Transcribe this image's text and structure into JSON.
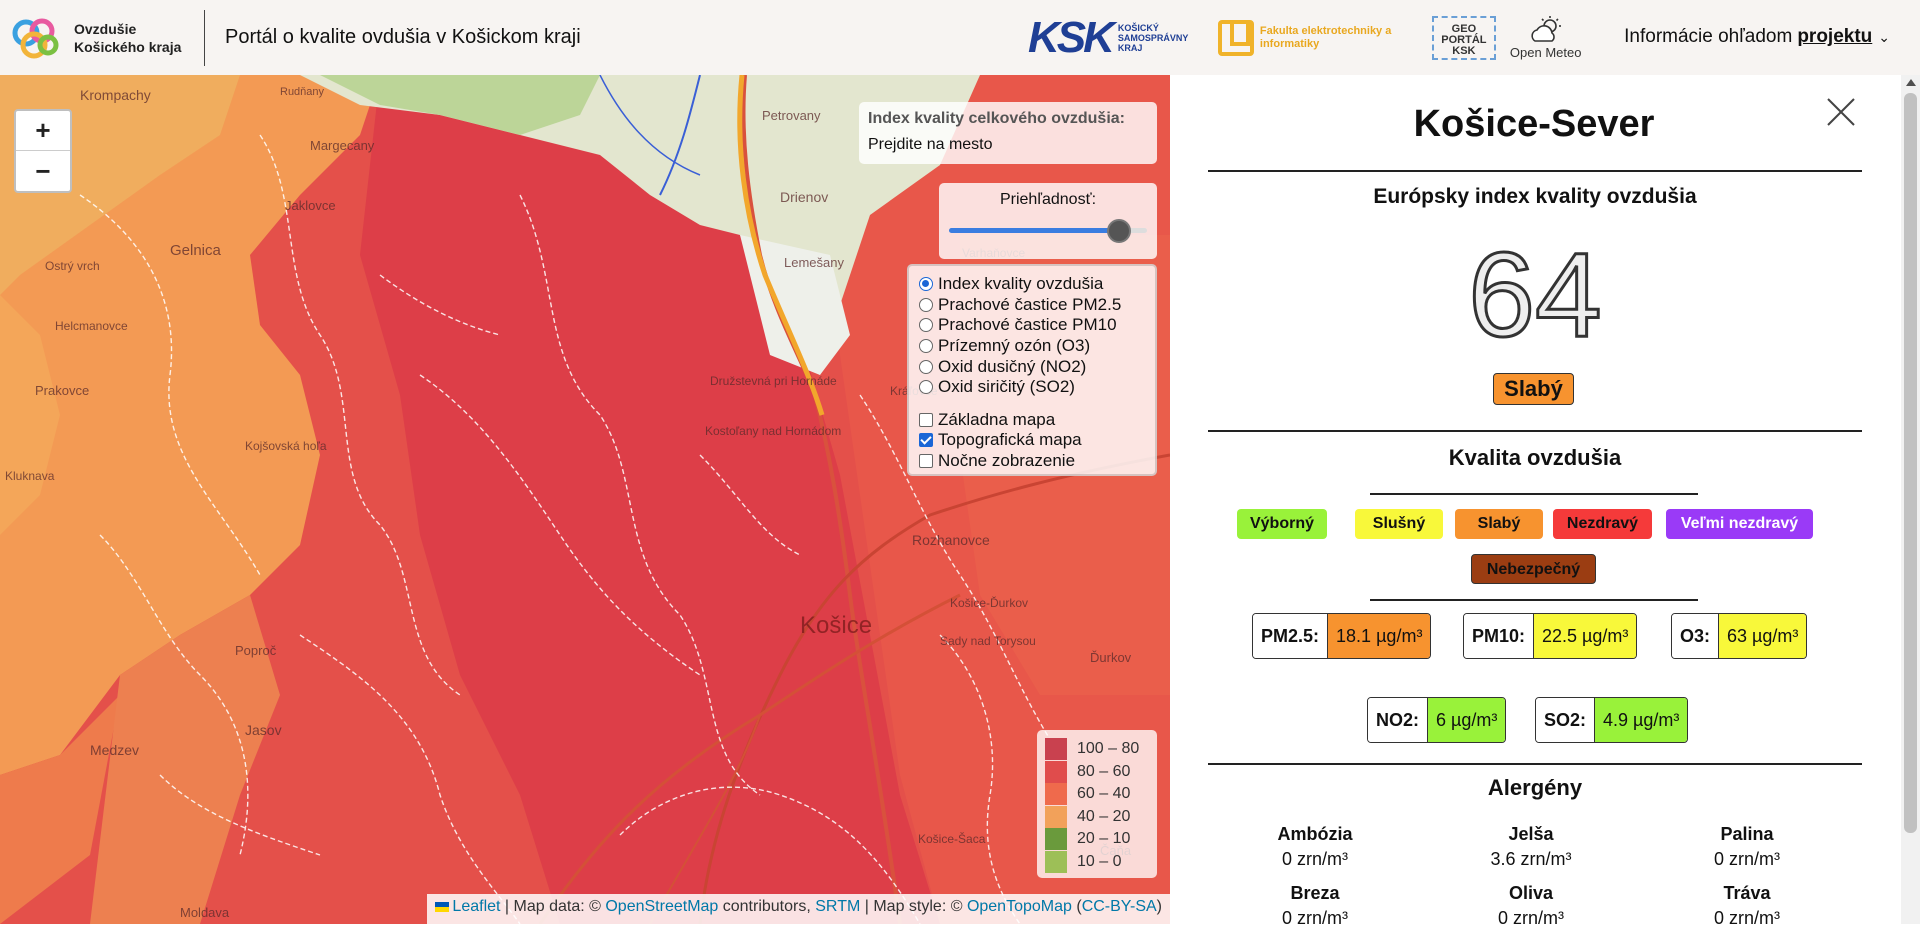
{
  "header": {
    "brand_line1": "Ovzdušie",
    "brand_line2": "Košického kraja",
    "portal_title": "Portál o kvalite ovdušia v Košickom kraji",
    "ksk_mark": "KSK",
    "ksk_text": "KOŠICKÝ SAMOSPRÁVNY KRAJ",
    "fei_text": "Fakulta elektrotechniky a informatiky",
    "geo_text": "GEO PORTÁL KSK",
    "meteo_text": "Open Meteo",
    "info_prefix": "Informácie ohľadom",
    "info_link": "projektu"
  },
  "map": {
    "zoom_in": "+",
    "zoom_out": "−",
    "aqi_info_title": "Index kvality celkového ovzdušia:",
    "aqi_info_hint": "Prejdite na mesto",
    "opacity_label": "Priehľadnosť:",
    "opacity_value": 0.86,
    "layers_radio": [
      {
        "label": "Index kvality ovzdušia",
        "checked": true
      },
      {
        "label": "Prachové častice PM2.5",
        "checked": false
      },
      {
        "label": "Prachové častice PM10",
        "checked": false
      },
      {
        "label": "Prízemný ozón (O3)",
        "checked": false
      },
      {
        "label": "Oxid dusičný (NO2)",
        "checked": false
      },
      {
        "label": "Oxid siričitý (SO2)",
        "checked": false
      }
    ],
    "layers_check": [
      {
        "label": "Základna mapa",
        "checked": false
      },
      {
        "label": "Topografická mapa",
        "checked": true
      },
      {
        "label": "Nočne zobrazenie",
        "checked": false
      }
    ],
    "legend": [
      {
        "label": "100 – 80",
        "color": "#c9414f"
      },
      {
        "label": "80 – 60",
        "color": "#e04c4c"
      },
      {
        "label": "60 – 40",
        "color": "#ef6a4c"
      },
      {
        "label": "40 – 20",
        "color": "#f2a15a"
      },
      {
        "label": "20 – 10",
        "color": "#6a9a3c"
      },
      {
        "label": "10 – 0",
        "color": "#9dbf57"
      }
    ],
    "place_labels": [
      "Krompachy",
      "Rudňany",
      "Margecany",
      "Jaklovce",
      "Gelnica",
      "Ostrý vrch",
      "Helcmanovce",
      "Prakovce",
      "Kojšovská hoľa",
      "Kluknava",
      "Petrovany",
      "Drienov",
      "Lemešany",
      "Varhaňovce",
      "Družstevná pri Hornáde",
      "Kostoľany nad Hornádom",
      "Rozhanovce",
      "Košice",
      "Košice-Ďurkov",
      "Sady nad Torysou",
      "Ďurkov",
      "Jasov",
      "Medzev",
      "Poproč",
      "Moldava",
      "Kráľovce",
      "Košice-Šaca",
      "Čaňa"
    ],
    "attribution": {
      "leaflet": "Leaflet",
      "sep1": " | Map data: © ",
      "osm": "OpenStreetMap",
      "contrib": " contributors, ",
      "srtm": "SRTM",
      "sep2": " | Map style: © ",
      "otm": "OpenTopoMap",
      "open": " (",
      "cc": "CC-BY-SA",
      "close": ")"
    }
  },
  "panel": {
    "station": "Košice-Sever",
    "eaqi_title": "Európsky index kvality ovzdušia",
    "aqi_value": "64",
    "status": "Slabý",
    "quality_title": "Kvalita ovzdušia",
    "categories": [
      {
        "label": "Výborný",
        "color": "#99f23a"
      },
      {
        "label": "Slušný",
        "color": "#f8f83a"
      },
      {
        "label": "Slabý",
        "color": "#f7932f"
      },
      {
        "label": "Nezdravý",
        "color": "#f53a3a"
      },
      {
        "label": "Veľmi nezdravý",
        "color": "#9a3af7"
      },
      {
        "label": "Nebezpečný",
        "color": "#9b3d12"
      }
    ],
    "pollutants": [
      {
        "name": "PM2.5:",
        "value": "18.1 µg/m³",
        "color": "#f7932f"
      },
      {
        "name": "PM10:",
        "value": "22.5 µg/m³",
        "color": "#f8f83a"
      },
      {
        "name": "O3:",
        "value": "63 µg/m³",
        "color": "#f8f83a"
      },
      {
        "name": "NO2:",
        "value": "6 µg/m³",
        "color": "#99f23a"
      },
      {
        "name": "SO2:",
        "value": "4.9 µg/m³",
        "color": "#99f23a"
      }
    ],
    "allergens_title": "Alergény",
    "allergens": [
      {
        "name": "Ambózia",
        "value": "0 zrn/m³"
      },
      {
        "name": "Jelša",
        "value": "3.6 zrn/m³"
      },
      {
        "name": "Palina",
        "value": "0 zrn/m³"
      },
      {
        "name": "Breza",
        "value": "0 zrn/m³"
      },
      {
        "name": "Oliva",
        "value": "0 zrn/m³"
      },
      {
        "name": "Tráva",
        "value": "0 zrn/m³"
      }
    ]
  }
}
